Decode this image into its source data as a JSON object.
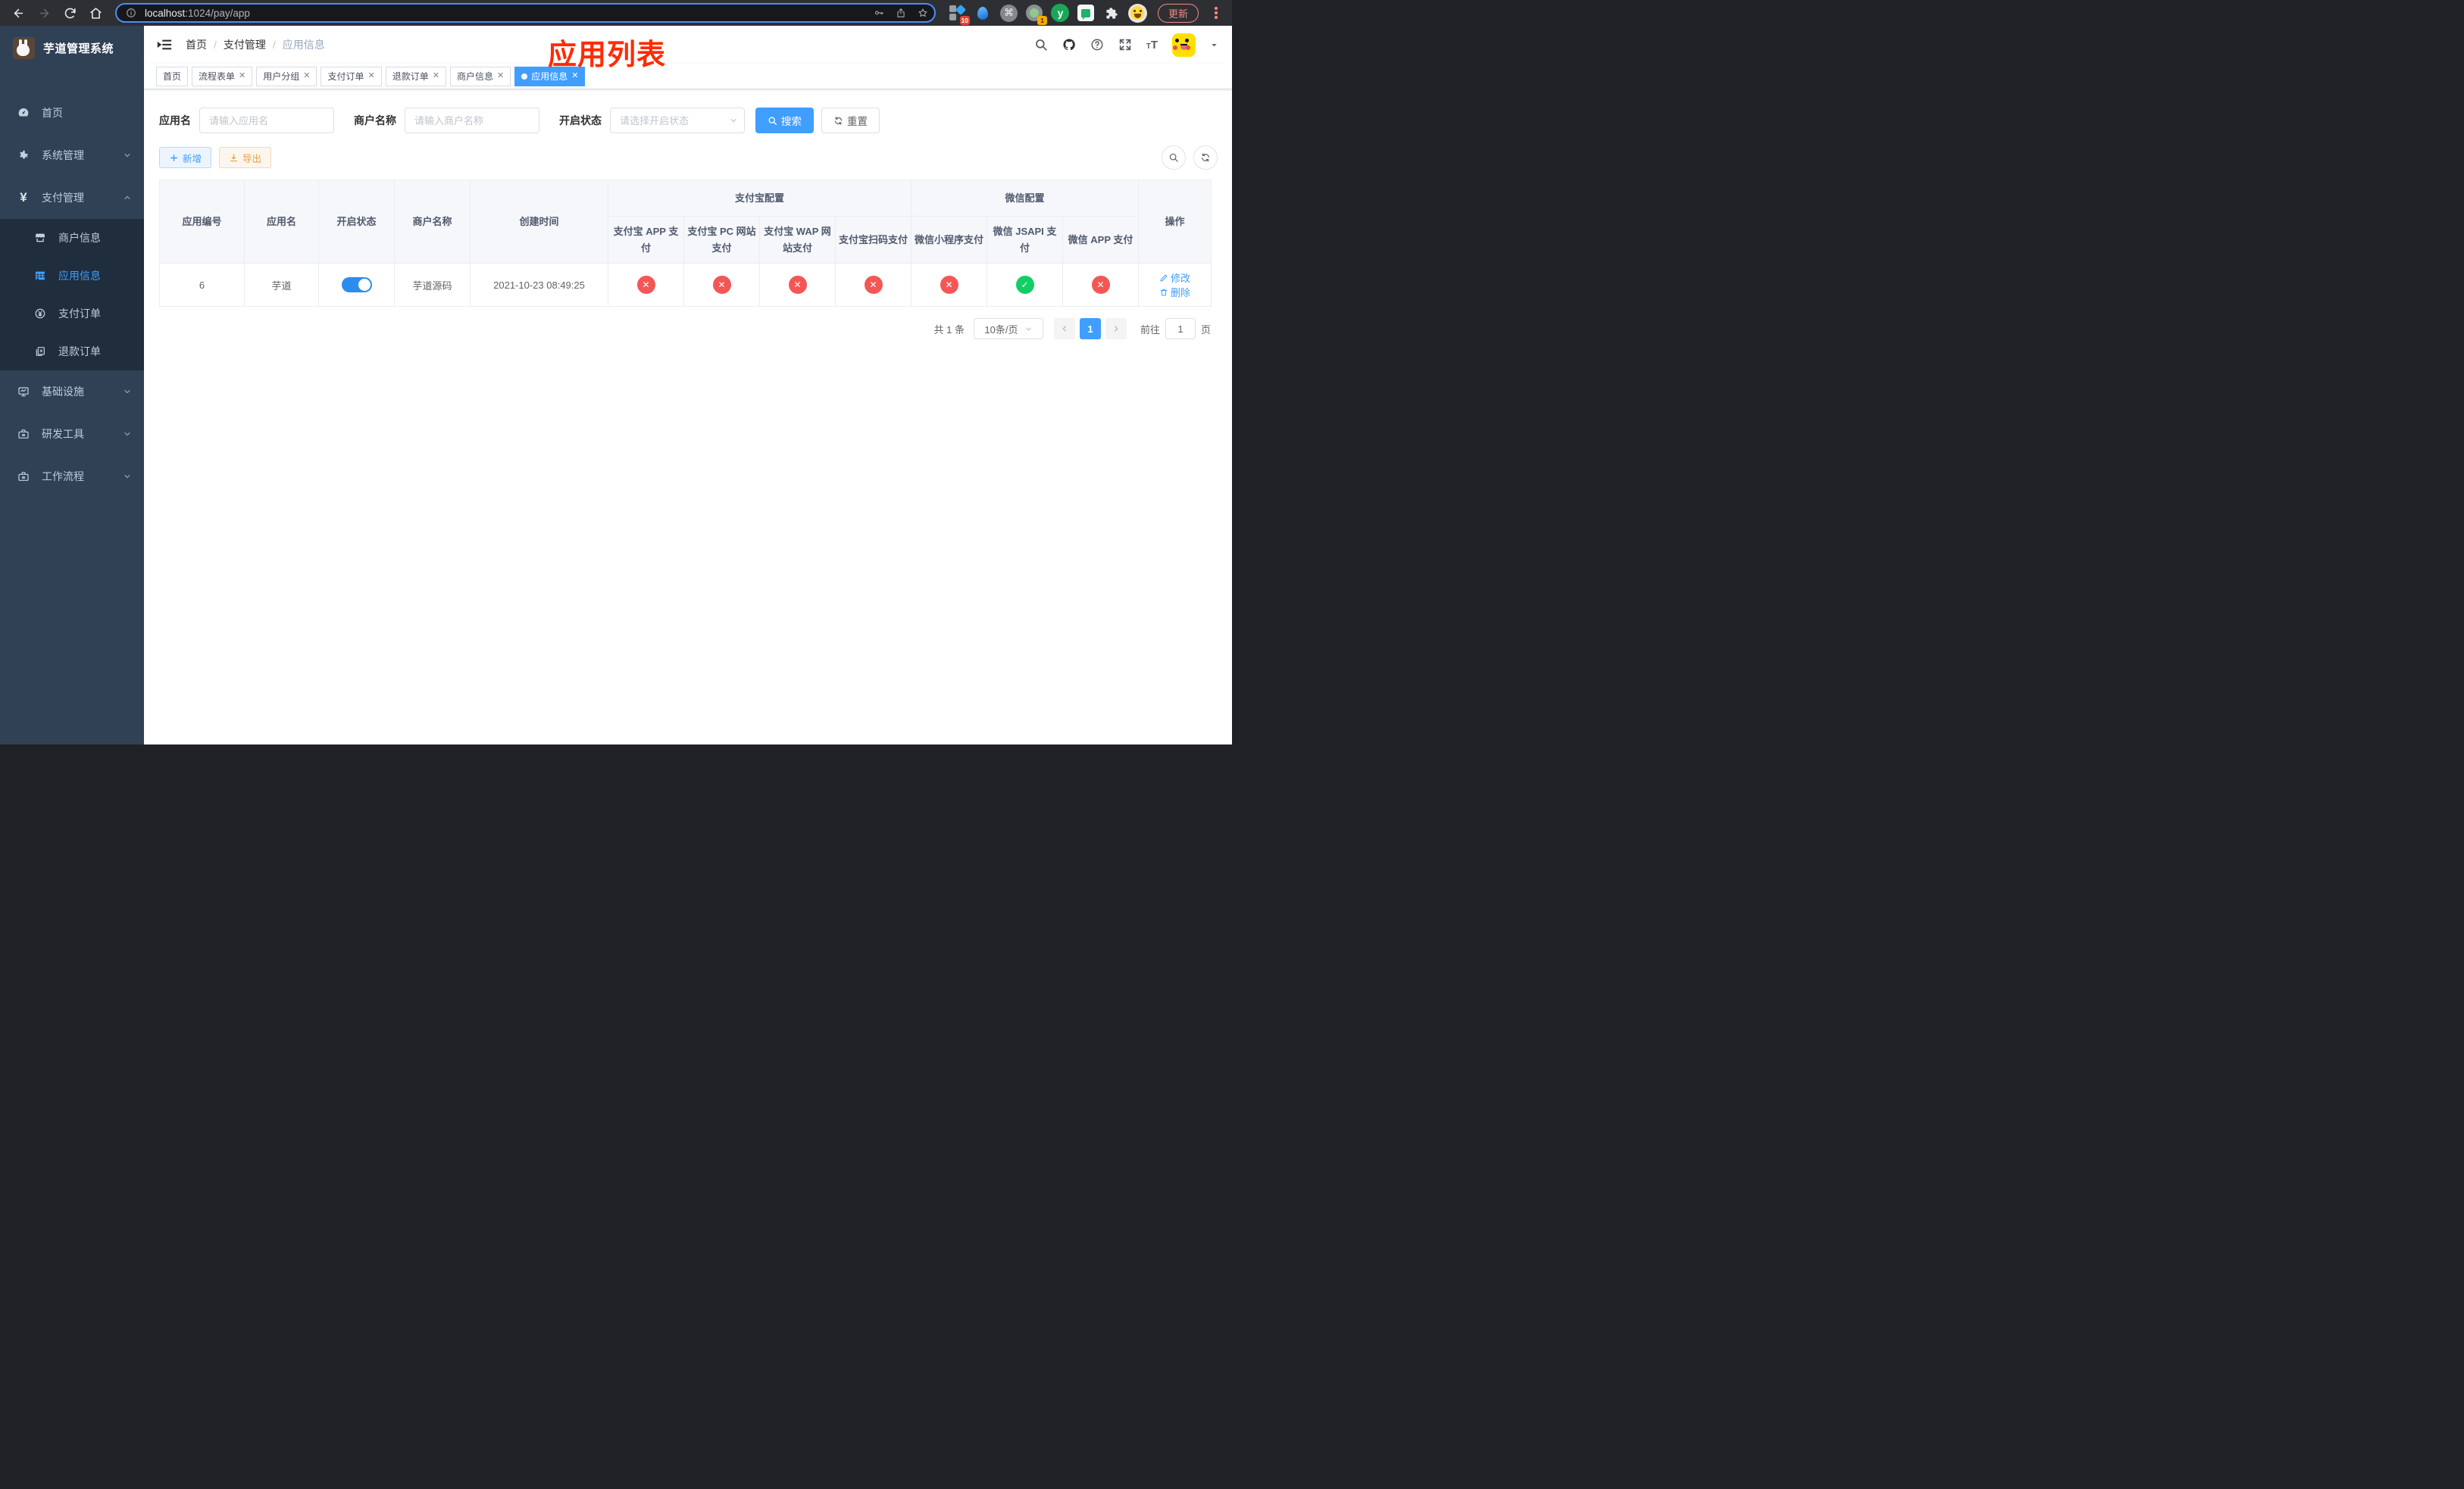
{
  "browser": {
    "url_host": "localhost",
    "url_rest": ":1024/pay/app",
    "update_label": "更新",
    "ext_badge_grid": "10",
    "ext_badge_cam": "1",
    "ext_y_letter": "y",
    "cmd_glyph": "⌘"
  },
  "sidebar": {
    "title": "芋道管理系统",
    "menu": [
      {
        "label": "首页",
        "icon": "dashboard-icon"
      },
      {
        "label": "系统管理",
        "icon": "gear-icon"
      },
      {
        "label": "支付管理",
        "icon": "yen-icon"
      },
      {
        "label": "商户信息",
        "icon": "shop-icon"
      },
      {
        "label": "应用信息",
        "icon": "grid-icon"
      },
      {
        "label": "支付订单",
        "icon": "yen-circle-icon"
      },
      {
        "label": "退款订单",
        "icon": "documents-icon"
      },
      {
        "label": "基础设施",
        "icon": "monitor-icon"
      },
      {
        "label": "研发工具",
        "icon": "toolbox-icon"
      },
      {
        "label": "工作流程",
        "icon": "toolbox-icon"
      }
    ]
  },
  "navbar": {
    "breadcrumb": {
      "home": "首页",
      "section": "支付管理",
      "current": "应用信息"
    },
    "icons": [
      "search",
      "github",
      "help",
      "fullscreen",
      "font-size"
    ]
  },
  "annotation": {
    "text": "应用列表",
    "color": "#ff2b00"
  },
  "tags": [
    {
      "label": "首页",
      "closable": false,
      "active": false
    },
    {
      "label": "流程表单",
      "closable": true,
      "active": false
    },
    {
      "label": "用户分组",
      "closable": true,
      "active": false
    },
    {
      "label": "支付订单",
      "closable": true,
      "active": false
    },
    {
      "label": "退款订单",
      "closable": true,
      "active": false
    },
    {
      "label": "商户信息",
      "closable": true,
      "active": false
    },
    {
      "label": "应用信息",
      "closable": true,
      "active": true
    }
  ],
  "close_glyph": "✕",
  "filters": {
    "app_name_label": "应用名",
    "app_name_placeholder": "请输入应用名",
    "merchant_label": "商户名称",
    "merchant_placeholder": "请输入商户名称",
    "status_label": "开启状态",
    "status_placeholder": "请选择开启状态",
    "search_label": "搜索",
    "reset_label": "重置"
  },
  "toolbar": {
    "add_label": "新增",
    "export_label": "导出"
  },
  "table": {
    "groups": {
      "alipay": "支付宝配置",
      "wechat": "微信配置"
    },
    "columns": [
      "应用编号",
      "应用名",
      "开启状态",
      "商户名称",
      "创建时间",
      "支付宝 APP 支付",
      "支付宝 PC 网站支付",
      "支付宝 WAP 网站支付",
      "支付宝扫码支付",
      "微信小程序支付",
      "微信 JSAPI 支付",
      "微信 APP 支付",
      "操作"
    ],
    "row": {
      "id": "6",
      "name": "芋道",
      "enabled": true,
      "merchant": "芋道源码",
      "created_at": "2021-10-23 08:49:25",
      "pay_flags": [
        false,
        false,
        false,
        false,
        false,
        true,
        false
      ],
      "edit_label": "修改",
      "delete_label": "删除"
    }
  },
  "pagination": {
    "total": "共 1 条",
    "page_size": "10条/页",
    "page": "1",
    "goto_label": "前往",
    "goto_value": "1",
    "unit_label": "页"
  },
  "colors": {
    "accent": "#409EFF",
    "danger": "#f45656",
    "success": "#13ce66",
    "sidebar_bg": "#304156",
    "submenu_bg": "#1f2d3d"
  }
}
